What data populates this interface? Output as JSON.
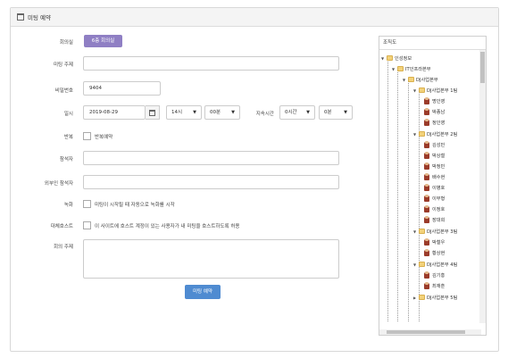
{
  "panel": {
    "title": "미팅 예약"
  },
  "form": {
    "room_label": "회의실",
    "room_button": "6층 회의실",
    "topic_label": "미팅 주제",
    "topic_value": "",
    "password_label": "비밀번호",
    "password_value": "9404",
    "datetime_label": "일시",
    "date_value": "2019-08-29",
    "hour_value": "14시",
    "minute_value": "00분",
    "duration_label": "지속시간",
    "duration_hour_value": "0시간",
    "duration_minute_value": "0분",
    "repeat_label": "반복",
    "repeat_checkbox_text": "반복예약",
    "participants_label": "참석자",
    "participants_value": "",
    "external_label": "외부인 참석자",
    "external_value": "",
    "record_label": "녹화",
    "record_checkbox_text": "미팅이 시작될 때 자동으로 녹화를 시작",
    "alt_host_label": "대체호스트",
    "alt_host_checkbox_text": "이 사이트에 호스트 계정이 있는 사용자가 내 미팅을 호스트하도록 허용",
    "content_label": "회의 주제",
    "submit_label": "미팅 예약"
  },
  "tree": {
    "title": "조직도",
    "root": "인성정보",
    "l1": "IT인프라본부",
    "l2": "DJ사업본부",
    "team1": "DJ사업본부 1팀",
    "team1_members": [
      "명인영",
      "박종남",
      "정인영"
    ],
    "team2": "DJ사업본부 2팀",
    "team2_members": [
      "김성민",
      "박상철",
      "박정민",
      "배수현",
      "이병호",
      "이부형",
      "이정호",
      "장대희"
    ],
    "team3": "DJ사업본부 3팀",
    "team3_members": [
      "박철우",
      "황상현"
    ],
    "team4": "DJ사업본부 4팀",
    "team4_members": [
      "김기홍",
      "최재훈"
    ],
    "team5": "DJ사업본부 5팀"
  }
}
